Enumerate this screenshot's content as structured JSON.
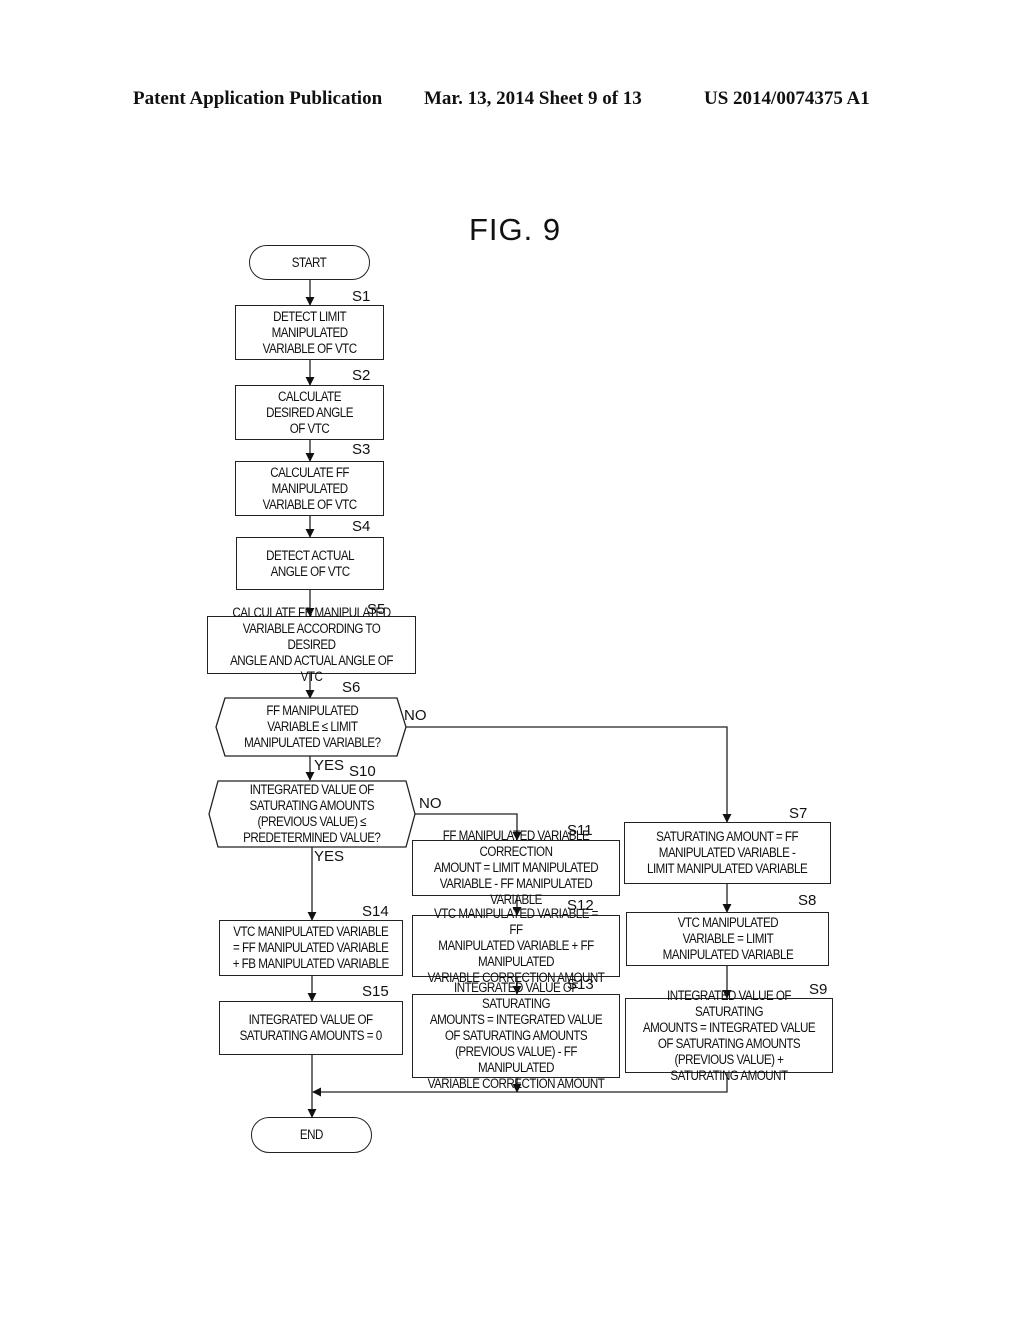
{
  "header": {
    "left": "Patent Application Publication",
    "middle": "Mar. 13, 2014  Sheet 9 of 13",
    "right": "US 2014/0074375 A1"
  },
  "figure": {
    "title": "FIG. 9",
    "start_label": "START",
    "end_label": "END",
    "steps": {
      "S1": {
        "id": "S1",
        "text": "DETECT LIMIT\nMANIPULATED\nVARIABLE OF VTC"
      },
      "S2": {
        "id": "S2",
        "text": "CALCULATE\nDESIRED ANGLE\nOF VTC"
      },
      "S3": {
        "id": "S3",
        "text": "CALCULATE FF\nMANIPULATED\nVARIABLE OF VTC"
      },
      "S4": {
        "id": "S4",
        "text": "DETECT ACTUAL\nANGLE OF VTC"
      },
      "S5": {
        "id": "S5",
        "text": "CALCULATE FB MANIPULATED\nVARIABLE ACCORDING TO DESIRED\nANGLE AND ACTUAL ANGLE OF VTC"
      },
      "S6": {
        "id": "S6",
        "text": "FF MANIPULATED\nVARIABLE ≤ LIMIT\nMANIPULATED VARIABLE?"
      },
      "S7": {
        "id": "S7",
        "text": "SATURATING AMOUNT = FF\nMANIPULATED VARIABLE -\nLIMIT MANIPULATED VARIABLE"
      },
      "S8": {
        "id": "S8",
        "text": "VTC MANIPULATED\nVARIABLE = LIMIT\nMANIPULATED VARIABLE"
      },
      "S9": {
        "id": "S9",
        "text": "INTEGRATED VALUE OF SATURATING\nAMOUNTS = INTEGRATED VALUE\nOF SATURATING AMOUNTS\n(PREVIOUS VALUE) + SATURATING AMOUNT"
      },
      "S10": {
        "id": "S10",
        "text": "INTEGRATED VALUE OF\nSATURATING AMOUNTS\n(PREVIOUS VALUE) ≤\nPREDETERMINED VALUE?"
      },
      "S11": {
        "id": "S11",
        "text": "FF MANIPULATED VARIABLE CORRECTION\nAMOUNT = LIMIT MANIPULATED\nVARIABLE - FF MANIPULATED VARIABLE"
      },
      "S12": {
        "id": "S12",
        "text": "VTC MANIPULATED VARIABLE = FF\nMANIPULATED VARIABLE + FF MANIPULATED\nVARIABLE CORRECTION AMOUNT"
      },
      "S13": {
        "id": "S13",
        "text": "INTEGRATED VALUE OF SATURATING\nAMOUNTS = INTEGRATED VALUE\nOF SATURATING AMOUNTS\n(PREVIOUS VALUE) - FF MANIPULATED\nVARIABLE CORRECTION AMOUNT"
      },
      "S14": {
        "id": "S14",
        "text": "VTC MANIPULATED VARIABLE\n= FF MANIPULATED VARIABLE\n+ FB MANIPULATED VARIABLE"
      },
      "S15": {
        "id": "S15",
        "text": "INTEGRATED VALUE OF\nSATURATING AMOUNTS = 0"
      }
    },
    "branch_labels": {
      "s6_no": "NO",
      "s6_yes": "YES",
      "s10_no": "NO",
      "s10_yes": "YES"
    }
  }
}
